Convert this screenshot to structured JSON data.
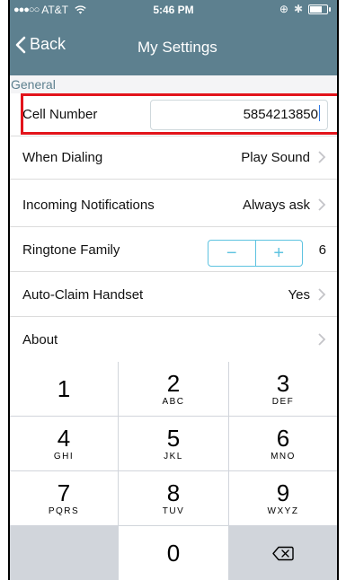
{
  "status_bar": {
    "carrier": "AT&T",
    "time": "5:46 PM"
  },
  "nav": {
    "back_label": "Back",
    "title": "My Settings"
  },
  "section": {
    "header": "General"
  },
  "settings": {
    "cell_number": {
      "label": "Cell Number",
      "value": "5854213850"
    },
    "when_dialing": {
      "label": "When Dialing",
      "value": "Play Sound"
    },
    "incoming_notifications": {
      "label": "Incoming Notifications",
      "value": "Always ask"
    },
    "ringtone_family": {
      "label": "Ringtone Family",
      "minus": "−",
      "plus": "+",
      "value": "6"
    },
    "auto_claim": {
      "label": "Auto-Claim Handset",
      "value": "Yes"
    },
    "about": {
      "label": "About"
    }
  },
  "keypad": {
    "keys": [
      {
        "num": "1",
        "letters": ""
      },
      {
        "num": "2",
        "letters": "ABC"
      },
      {
        "num": "3",
        "letters": "DEF"
      },
      {
        "num": "4",
        "letters": "GHI"
      },
      {
        "num": "5",
        "letters": "JKL"
      },
      {
        "num": "6",
        "letters": "MNO"
      },
      {
        "num": "7",
        "letters": "PQRS"
      },
      {
        "num": "8",
        "letters": "TUV"
      },
      {
        "num": "9",
        "letters": "WXYZ"
      },
      {
        "num": "0",
        "letters": ""
      }
    ]
  },
  "colors": {
    "nav_background": "#5d808f",
    "highlight": "#e2141b",
    "stepper_accent": "#5ec3e0"
  }
}
